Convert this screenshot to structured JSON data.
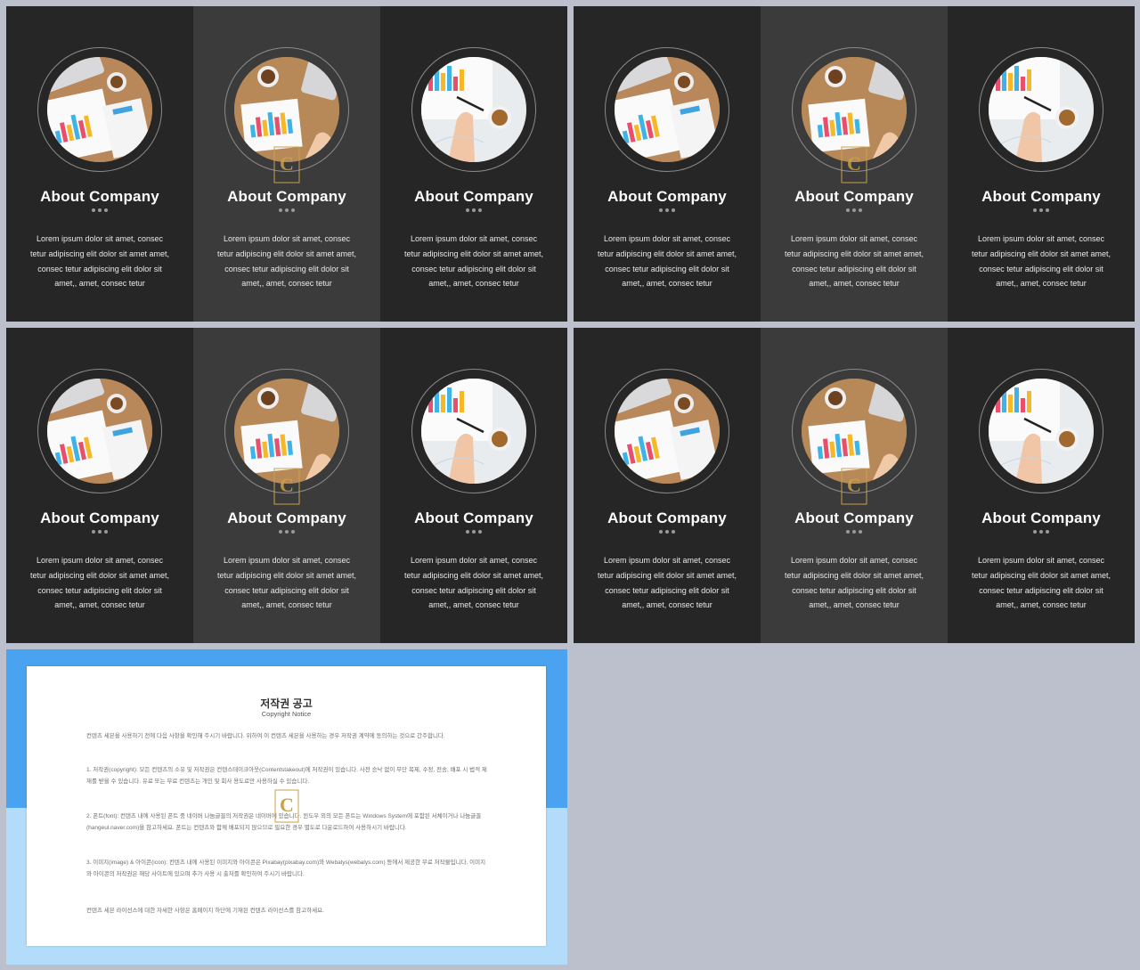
{
  "column": {
    "title": "About Company",
    "text": "Lorem ipsum dolor sit amet, consec tetur adipiscing elit dolor sit amet amet, consec tetur adipiscing elit dolor sit amet,, amet, consec tetur"
  },
  "colors": {
    "background": "#bcc0cc",
    "dark_column": "#262626",
    "mid_column": "#3b3b3b",
    "notice_blue": "#4aa3f0",
    "notice_light_blue": "#b2dcfa"
  },
  "icons": [
    "desk-photo",
    "watermark-logo"
  ],
  "notice": {
    "title": "저작권 공고",
    "subtitle": "Copyright Notice",
    "paragraphs": [
      "컨텐츠 세븐을 사용하기 전에 다음 사항을 확인해 주시기 바랍니다. 위하여 이 컨텐츠 세븐을 사용하는 경우 저작권 계약에 동의하는 것으로 간주합니다.",
      "1. 저작권(copyright): 모든 컨텐츠의 소유 및 저작권은 컨텐스테이크아웃(Contentstakeout)에 저작권이 있습니다. 사전 승낙 없이 무단 복제, 수정, 전송, 배포 시 법적 제재를 받을 수 있습니다. 유료 또는 무료 컨텐츠는 개인 및 회사 용도로만 사용하실 수 있습니다.",
      "2. 폰트(font): 컨텐츠 내에 사용된 폰트 중 네이버 나눔글꼴의 저작권은 네이버에 있습니다. 윈도우 외의 모든 폰트는 Windows System에 포함된 서체이거나 나눔글꼴(hangeul.naver.com)을 참고하세요. 폰트는 컨텐츠와 함께 배포되지 않으므로 필요한 경우 별도로 다운로드하여 사용하시기 바랍니다.",
      "3. 이미지(image) & 아이콘(icon): 컨텐츠 내에 사용된 이미지와 아이콘은 Pixabay(pixabay.com)와 Webalys(webalys.com) 등에서 제공한 무료 저작물입니다. 이미지와 아이콘의 저작권은 해당 사이트에 있으며 추가 사용 시 출처를 확인하여 주시기 바랍니다.",
      "컨텐츠 세븐 라이선스에 대한 자세한 사항은 홈페이지 하단에 기재된 컨텐츠 라이선스를 참고하세요."
    ]
  }
}
